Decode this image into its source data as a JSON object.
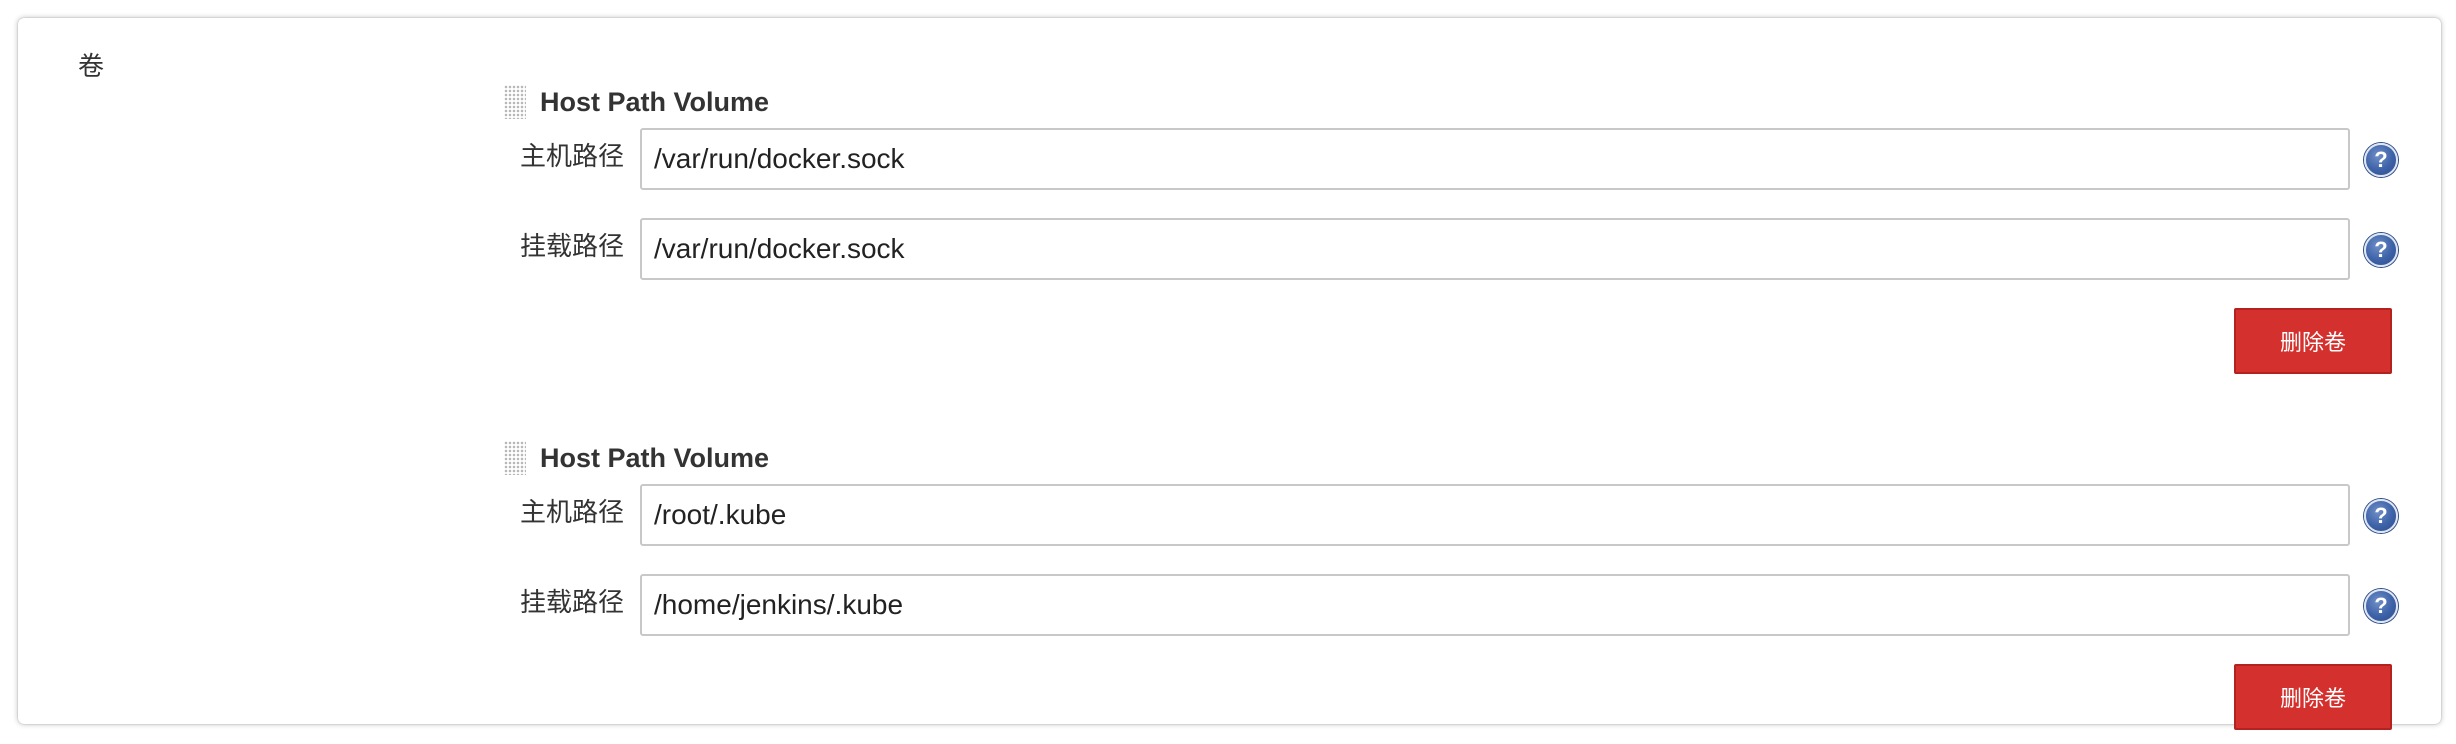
{
  "section": {
    "label": "卷"
  },
  "volumes": [
    {
      "title": "Host Path Volume",
      "host_path_label": "主机路径",
      "host_path_value": "/var/run/docker.sock",
      "mount_path_label": "挂载路径",
      "mount_path_value": "/var/run/docker.sock",
      "delete_label": "删除卷"
    },
    {
      "title": "Host Path Volume",
      "host_path_label": "主机路径",
      "host_path_value": "/root/.kube",
      "mount_path_label": "挂载路径",
      "mount_path_value": "/home/jenkins/.kube",
      "delete_label": "删除卷"
    }
  ],
  "help_icon_glyph": "?",
  "colors": {
    "delete_button": "#d4302d",
    "help_icon": "#3e62a8",
    "text": "#333333"
  }
}
